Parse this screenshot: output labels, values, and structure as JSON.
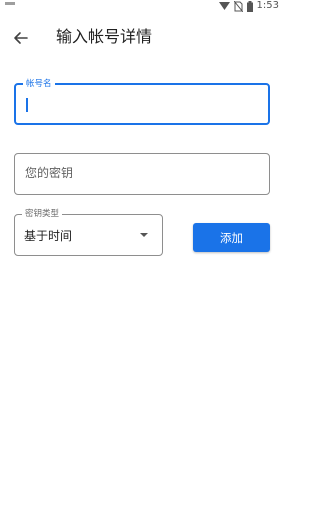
{
  "status_bar": {
    "time": "1:53"
  },
  "app_bar": {
    "title": "输入帐号详情"
  },
  "form": {
    "account_name": {
      "label": "帐号名",
      "value": ""
    },
    "secret_key": {
      "placeholder": "您的密钥",
      "value": ""
    },
    "key_type": {
      "label": "密钥类型",
      "selected": "基于时间"
    },
    "add_button": {
      "label": "添加"
    }
  },
  "colors": {
    "accent": "#1a73e8",
    "border": "#8e8e8e",
    "text": "#212121"
  }
}
